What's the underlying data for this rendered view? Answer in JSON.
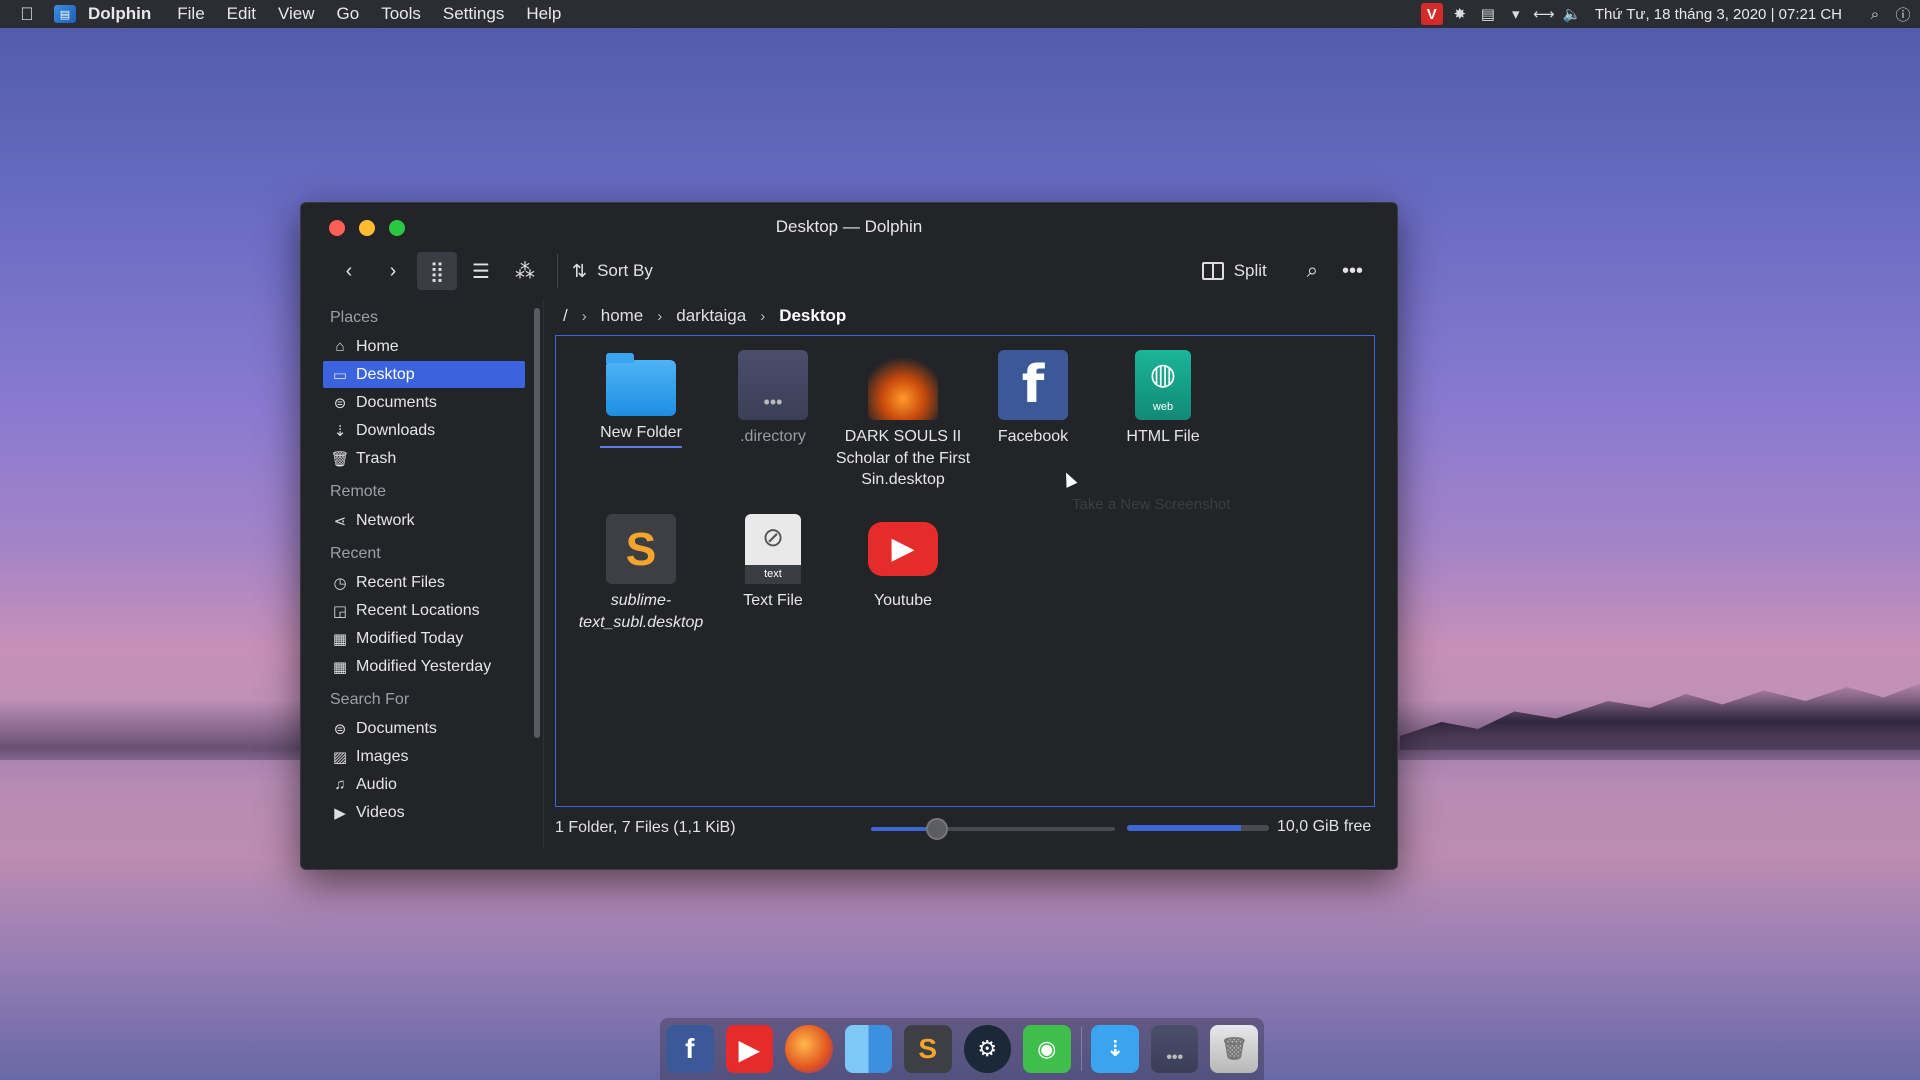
{
  "menubar": {
    "app_name": "Dolphin",
    "menus": [
      "File",
      "Edit",
      "View",
      "Go",
      "Tools",
      "Settings",
      "Help"
    ],
    "clock": "Thứ Tư, 18 tháng 3, 2020 | 07:21 CH"
  },
  "window": {
    "title": "Desktop — Dolphin"
  },
  "toolbar": {
    "sort_by": "Sort By",
    "split": "Split"
  },
  "sidebar": {
    "places_title": "Places",
    "places": [
      "Home",
      "Desktop",
      "Documents",
      "Downloads",
      "Trash"
    ],
    "remote_title": "Remote",
    "remote": [
      "Network"
    ],
    "recent_title": "Recent",
    "recent": [
      "Recent Files",
      "Recent Locations",
      "Modified Today",
      "Modified Yesterday"
    ],
    "search_title": "Search For",
    "search": [
      "Documents",
      "Images",
      "Audio",
      "Videos"
    ]
  },
  "breadcrumb": {
    "root": "/",
    "items": [
      "home",
      "darktaiga"
    ],
    "current": "Desktop"
  },
  "files": [
    {
      "name": "New Folder",
      "icon": "folder-icon"
    },
    {
      "name": ".directory",
      "icon": "directory-file-icon"
    },
    {
      "name": "DARK SOULS II Scholar of the First Sin.desktop",
      "icon": "dark-souls-icon"
    },
    {
      "name": "Facebook",
      "icon": "facebook-icon"
    },
    {
      "name": "HTML File",
      "icon": "html-file-icon",
      "tag": "web"
    },
    {
      "name": "sublime-text_subl.desktop",
      "icon": "sublime-text-icon"
    },
    {
      "name": "Text File",
      "icon": "text-file-icon",
      "tag": "text"
    },
    {
      "name": "Youtube",
      "icon": "youtube-icon"
    }
  ],
  "ghost_tooltip": "Take a New Screenshot",
  "statusbar": {
    "summary": "1 Folder, 7 Files (1,1 KiB)",
    "free": "10,0 GiB free",
    "zoom_level": 0.27,
    "disk_used_fraction": 0.8
  },
  "colors": {
    "accent": "#3b63dd",
    "window_bg": "#232428",
    "menubar_bg": "#2b2d33"
  }
}
